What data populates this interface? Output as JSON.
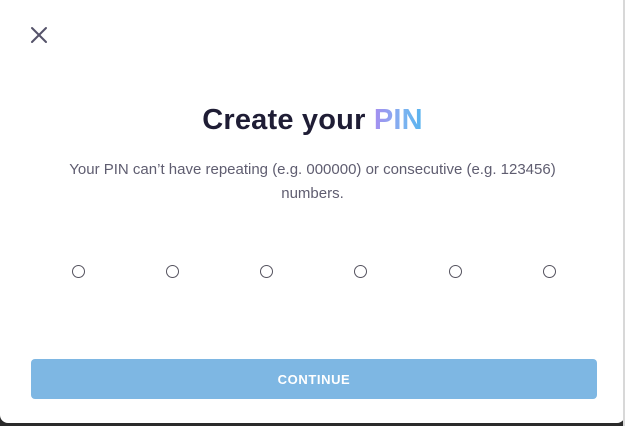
{
  "modal": {
    "title_prefix": "Create your ",
    "title_accent": "PIN",
    "description": "Your PIN can’t have repeating (e.g. 000000) or consecutive (e.g. 123456) numbers.",
    "close_icon": "close-icon",
    "pin_length": 6,
    "continue_label": "CONTINUE"
  },
  "colors": {
    "title": "#1f1d35",
    "accent_start": "#a58ef0",
    "accent_end": "#54b3ef",
    "button_bg": "#7eb7e3",
    "text_muted": "#5f5d70"
  }
}
